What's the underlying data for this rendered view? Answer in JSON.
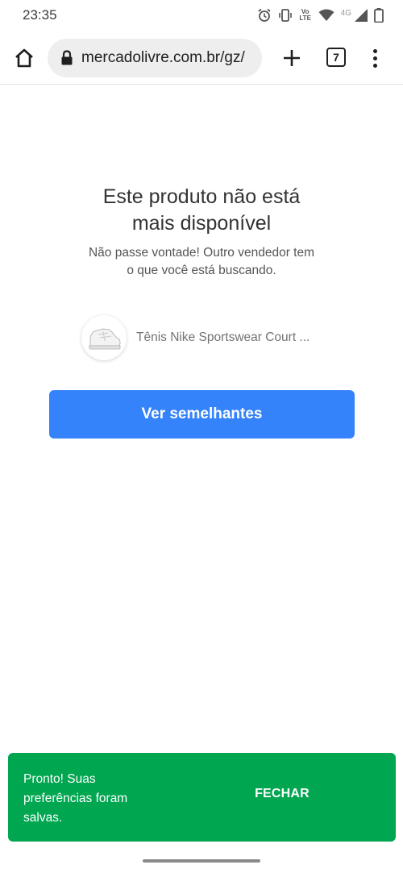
{
  "status_bar": {
    "time": "23:35",
    "icons": [
      "alarm-icon",
      "vibrate-icon",
      "volte-icon",
      "wifi-icon",
      "signal-icon",
      "battery-icon"
    ],
    "volte_label": "Vo LTE",
    "network_label": "4G"
  },
  "browser": {
    "url": "mercadolivre.com.br/gz/",
    "tab_count": "7",
    "icons": [
      "home-icon",
      "lock-icon",
      "plus-icon",
      "more-vert-icon"
    ]
  },
  "main": {
    "title_line1": "Este produto não está",
    "title_line2": "mais disponível",
    "subtitle_line1": "Não passe vontade! Outro vendedor tem",
    "subtitle_line2": "o que você está buscando.",
    "product_name": "Tênis Nike Sportswear Court ...",
    "cta_label": "Ver semelhantes"
  },
  "snackbar": {
    "message_line1": "Pronto! Suas",
    "message_line2": "preferências foram",
    "message_line3": "salvas.",
    "action_label": "FECHAR"
  },
  "colors": {
    "accent_blue": "#3483fa",
    "snackbar_green": "#00a650",
    "url_background": "#eeeeee"
  }
}
